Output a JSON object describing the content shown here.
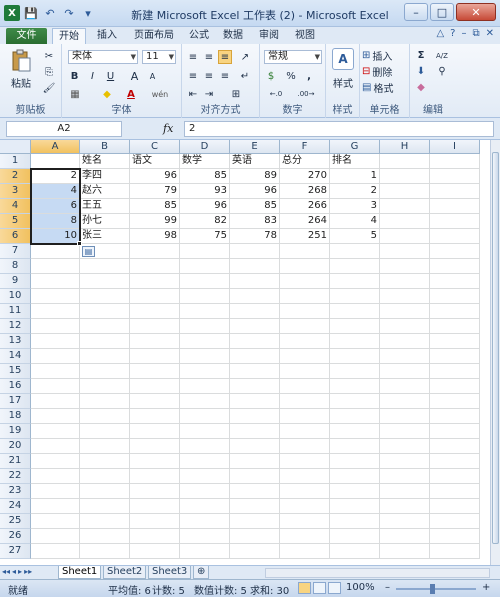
{
  "window": {
    "title": "新建 Microsoft Excel 工作表 (2) - Microsoft Excel",
    "minimize": "–",
    "maximize": "□",
    "close": "✕"
  },
  "qat": {
    "app_icon": "X",
    "save_icon": "💾",
    "undo_icon": "↶",
    "redo_icon": "↷",
    "more_icon": "▾"
  },
  "tabs": {
    "file": "文件",
    "items": [
      "开始",
      "插入",
      "页面布局",
      "公式",
      "数据",
      "审阅",
      "视图"
    ],
    "help_icons": [
      "△",
      "?",
      "–",
      "⧉",
      "✕"
    ]
  },
  "ribbon": {
    "clipboard": {
      "label": "剪贴板",
      "paste": "粘贴"
    },
    "font": {
      "label": "字体",
      "font_name": "宋体",
      "font_size": "11",
      "bold": "B",
      "italic": "I",
      "underline": "U",
      "grow": "A",
      "shrink": "A",
      "fill_icon": "◆",
      "color_letter": "A",
      "wen": "wén"
    },
    "alignment": {
      "label": "对齐方式"
    },
    "number": {
      "label": "数字",
      "format": "常规",
      "currency": "$",
      "percent": "%",
      "comma": ",",
      "inc": "←.0",
      "dec": ".00→"
    },
    "styles": {
      "label": "样式",
      "button": "样式"
    },
    "cells": {
      "label": "单元格",
      "insert": "插入",
      "delete": "删除",
      "format": "格式"
    },
    "editing": {
      "label": "编辑",
      "sum": "Σ",
      "sort": "A/Z",
      "find": "⚲"
    }
  },
  "formula_bar": {
    "name_box": "A2",
    "fx": "fx",
    "value": "2"
  },
  "grid": {
    "columns": [
      "A",
      "B",
      "C",
      "D",
      "E",
      "F",
      "G",
      "H",
      "I"
    ],
    "rows": [
      "1",
      "2",
      "3",
      "4",
      "5",
      "6",
      "7",
      "8",
      "9",
      "10",
      "11",
      "12",
      "13",
      "14",
      "15",
      "16",
      "17",
      "18",
      "19",
      "20",
      "21",
      "22",
      "23",
      "24",
      "25",
      "26",
      "27"
    ],
    "header_row": [
      "",
      "姓名",
      "语文",
      "数学",
      "英语",
      "总分",
      "排名",
      "",
      ""
    ],
    "data": [
      [
        "2",
        "李四",
        "96",
        "85",
        "89",
        "270",
        "1",
        "",
        ""
      ],
      [
        "4",
        "赵六",
        "79",
        "93",
        "96",
        "268",
        "2",
        "",
        ""
      ],
      [
        "6",
        "王五",
        "85",
        "96",
        "85",
        "266",
        "3",
        "",
        ""
      ],
      [
        "8",
        "孙七",
        "99",
        "82",
        "83",
        "264",
        "4",
        "",
        ""
      ],
      [
        "10",
        "张三",
        "98",
        "75",
        "78",
        "251",
        "5",
        "",
        ""
      ]
    ],
    "paste_options_icon": "▤"
  },
  "sheets": {
    "nav": [
      "◂◂",
      "◂",
      "▸",
      "▸▸"
    ],
    "tabs": [
      "Sheet1",
      "Sheet2",
      "Sheet3"
    ],
    "new_icon": "⊕"
  },
  "status": {
    "mode": "就绪",
    "average": "平均值: 6",
    "count": "计数: 5",
    "numeric_count": "数值计数: 5",
    "sum": "求和: 30",
    "zoom": "100%",
    "zoom_minus": "–",
    "zoom_plus": "+"
  }
}
